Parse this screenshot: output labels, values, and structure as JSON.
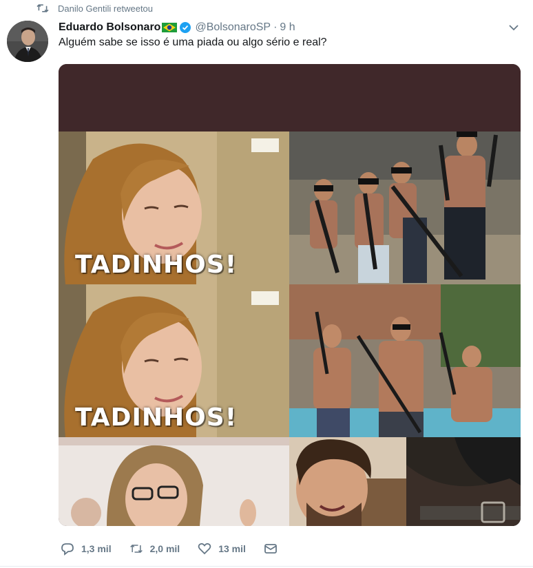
{
  "retweet": {
    "icon": "retweet-icon",
    "text": "Danilo Gentili retweetou"
  },
  "tweet": {
    "author_name": "Eduardo Bolsonaro",
    "flag": "brazil-flag-icon",
    "verified": "verified-badge-icon",
    "handle": "@BolsonaroSP",
    "separator": "·",
    "time": "9 h",
    "text": "Alguém sabe se isso é uma piada ou algo sério e real?"
  },
  "media": {
    "captions": [
      "TADINHOS!",
      "TADINHOS!"
    ],
    "background_color": "#40282a"
  },
  "actions": {
    "reply_count": "1,3 mil",
    "retweet_count": "2,0 mil",
    "like_count": "13 mil"
  },
  "colors": {
    "secondary_text": "#657786",
    "verified_blue": "#1da1f2",
    "primary_text": "#14171a"
  }
}
